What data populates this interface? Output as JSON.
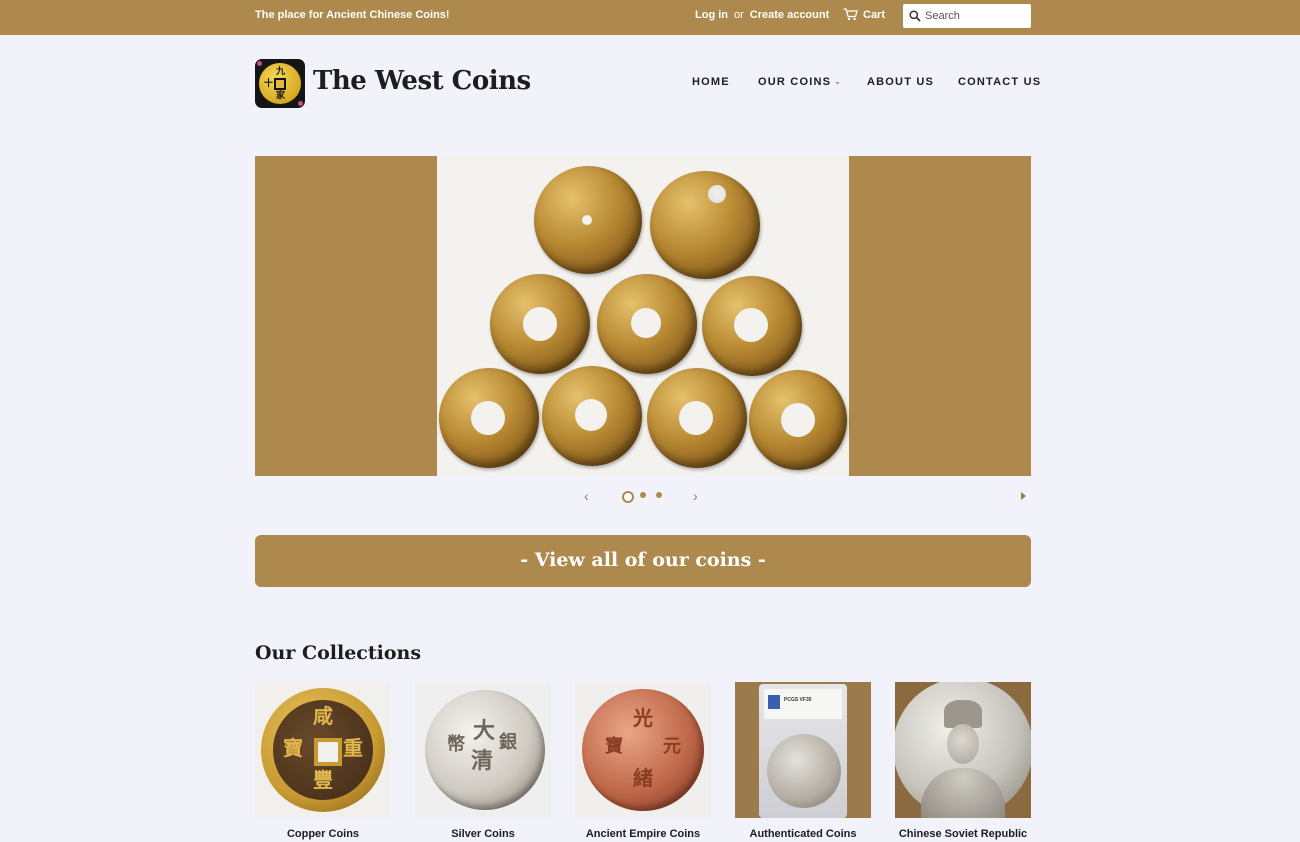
{
  "topbar": {
    "tagline": "The place for Ancient Chinese Coins!",
    "login": "Log in",
    "or": "or",
    "create_account": "Create account",
    "cart": "Cart",
    "search_placeholder": "Search"
  },
  "header": {
    "brand": "The West Coins",
    "logo_glyphs": [
      "九",
      "十",
      "家"
    ],
    "nav": [
      {
        "label": "HOME"
      },
      {
        "label": "OUR COINS",
        "caret": "⌵"
      },
      {
        "label": "ABOUT US"
      },
      {
        "label": "CONTACT US"
      }
    ]
  },
  "slideshow": {
    "prev": "‹",
    "next": "›",
    "slide_count": 3,
    "active_slide": 1
  },
  "cta": {
    "label": "- View all of our coins -"
  },
  "collections": {
    "title": "Our Collections",
    "items": [
      {
        "label": "Copper Coins",
        "glyphs": [
          "咸",
          "豐",
          "重",
          "寶"
        ]
      },
      {
        "label": "Silver Coins",
        "glyphs": [
          "大",
          "清",
          "銀",
          "幣"
        ]
      },
      {
        "label": "Ancient Empire Coins",
        "glyphs": [
          "光",
          "緒",
          "元",
          "寶"
        ]
      },
      {
        "label": "Authenticated Coins",
        "slab_text": "PCGS VF35"
      },
      {
        "label": "Chinese Soviet Republic"
      }
    ]
  },
  "colors": {
    "accent": "#ae894d",
    "background": "#f1f2fa",
    "text": "#1c1d1d"
  }
}
